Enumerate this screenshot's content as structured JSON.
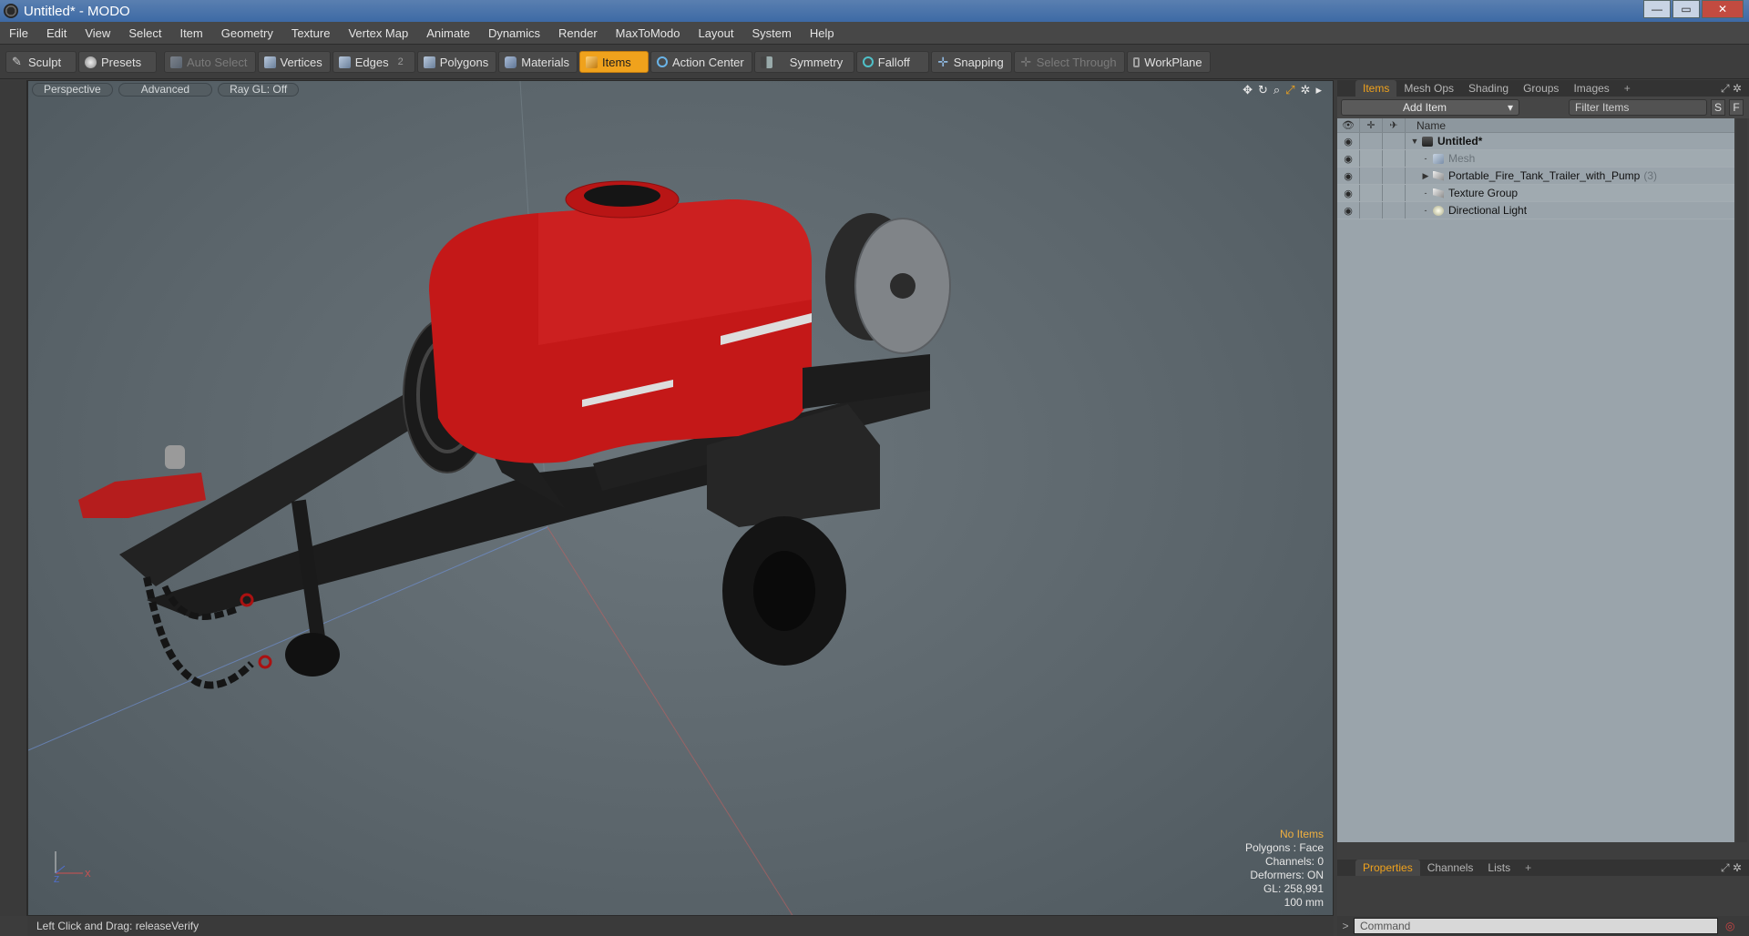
{
  "window": {
    "title": "Untitled* - MODO",
    "btn_min": "—",
    "btn_max": "▭",
    "btn_close": "✕"
  },
  "menu": [
    "File",
    "Edit",
    "View",
    "Select",
    "Item",
    "Geometry",
    "Texture",
    "Vertex Map",
    "Animate",
    "Dynamics",
    "Render",
    "MaxToModo",
    "Layout",
    "System",
    "Help"
  ],
  "toolbar": {
    "sculpt": "Sculpt",
    "presets": "Presets",
    "auto_select": "Auto Select",
    "vertices": "Vertices",
    "edges": "Edges",
    "edges_count": "2",
    "polygons": "Polygons",
    "materials": "Materials",
    "items": "Items",
    "action_center": "Action Center",
    "symmetry": "Symmetry",
    "falloff": "Falloff",
    "snapping": "Snapping",
    "select_through": "Select Through",
    "workplane": "WorkPlane"
  },
  "viewport": {
    "perspective": "Perspective",
    "advanced": "Advanced",
    "ray_gl": "Ray GL: Off",
    "stats": {
      "no_items": "No Items",
      "polygons": "Polygons : Face",
      "channels": "Channels: 0",
      "deformers": "Deformers: ON",
      "gl": "GL: 258,991",
      "scale": "100 mm"
    },
    "axis_x": "X",
    "axis_z": "Z"
  },
  "status_bar": "Left Click and Drag:  releaseVerify",
  "panel": {
    "tabs": [
      "Items",
      "Mesh Ops",
      "Shading",
      "Groups",
      "Images"
    ],
    "add_item": "Add Item",
    "filter_placeholder": "Filter Items",
    "s_btn": "S",
    "f_btn": "F",
    "column_name": "Name",
    "rows": [
      {
        "name": "Untitled*",
        "count": ""
      },
      {
        "name": "Mesh",
        "count": ""
      },
      {
        "name": "Portable_Fire_Tank_Trailer_with_Pump",
        "count": "(3)"
      },
      {
        "name": "Texture Group",
        "count": ""
      },
      {
        "name": "Directional Light",
        "count": ""
      }
    ]
  },
  "bottom_panel": {
    "tabs": [
      "Properties",
      "Channels",
      "Lists"
    ],
    "command_placeholder": "Command"
  },
  "colors": {
    "accent": "#f0a21c",
    "tank_red": "#c41818",
    "viewport_bg": "#5f696f"
  }
}
